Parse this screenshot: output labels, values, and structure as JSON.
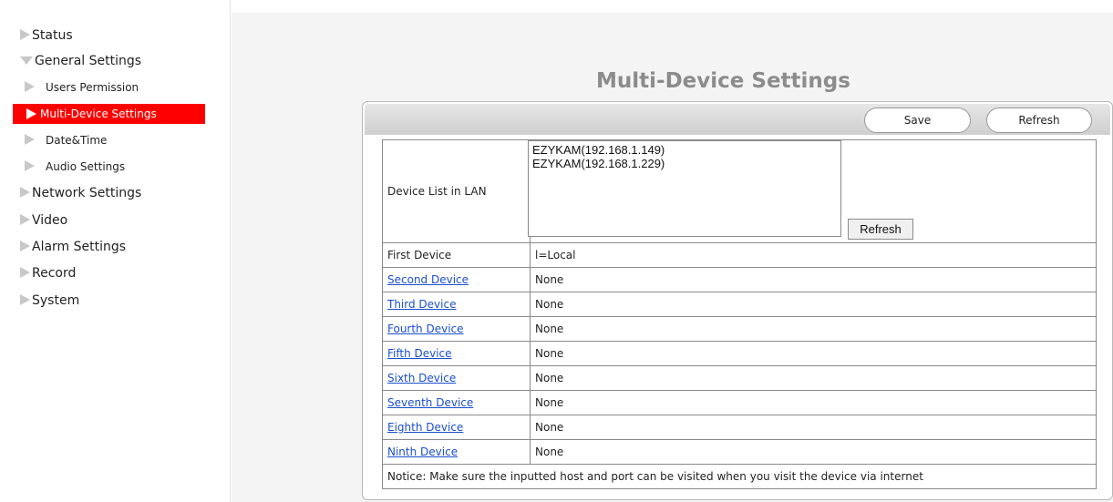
{
  "sidebar": {
    "items": [
      {
        "label": "Status"
      },
      {
        "label": "General Settings"
      },
      {
        "label": "Network Settings"
      },
      {
        "label": "Video"
      },
      {
        "label": "Alarm Settings"
      },
      {
        "label": "Record"
      },
      {
        "label": "System"
      }
    ],
    "subitems": [
      {
        "label": "Users Permission"
      },
      {
        "label": "Multi-Device Settings"
      },
      {
        "label": "Date&Time"
      },
      {
        "label": "Audio Settings"
      }
    ]
  },
  "main": {
    "title": "Multi-Device Settings",
    "toolbar": {
      "save_label": "Save",
      "refresh_label": "Refresh"
    },
    "device_list": {
      "label": "Device List in LAN",
      "entries": [
        "EZYKAM(192.168.1.149)",
        "EZYKAM(192.168.1.229)"
      ],
      "refresh_label": "Refresh"
    },
    "devices": [
      {
        "label": "First Device",
        "value": "l=Local"
      },
      {
        "label": "Second Device",
        "value": "None"
      },
      {
        "label": "Third Device",
        "value": "None"
      },
      {
        "label": "Fourth Device",
        "value": "None"
      },
      {
        "label": "Fifth Device",
        "value": "None"
      },
      {
        "label": "Sixth Device",
        "value": "None"
      },
      {
        "label": "Seventh Device",
        "value": "None"
      },
      {
        "label": "Eighth Device",
        "value": "None"
      },
      {
        "label": "Ninth Device",
        "value": "None"
      }
    ],
    "notice": "Notice: Make sure the inputted host and port can be visited when you visit the device via internet"
  },
  "colors": {
    "active_bg": "#ff0000",
    "link": "#1a4fcc",
    "title": "#8c8c8c"
  },
  "icons": {
    "collapsed": "triangle-right-icon",
    "expanded": "triangle-down-icon"
  }
}
